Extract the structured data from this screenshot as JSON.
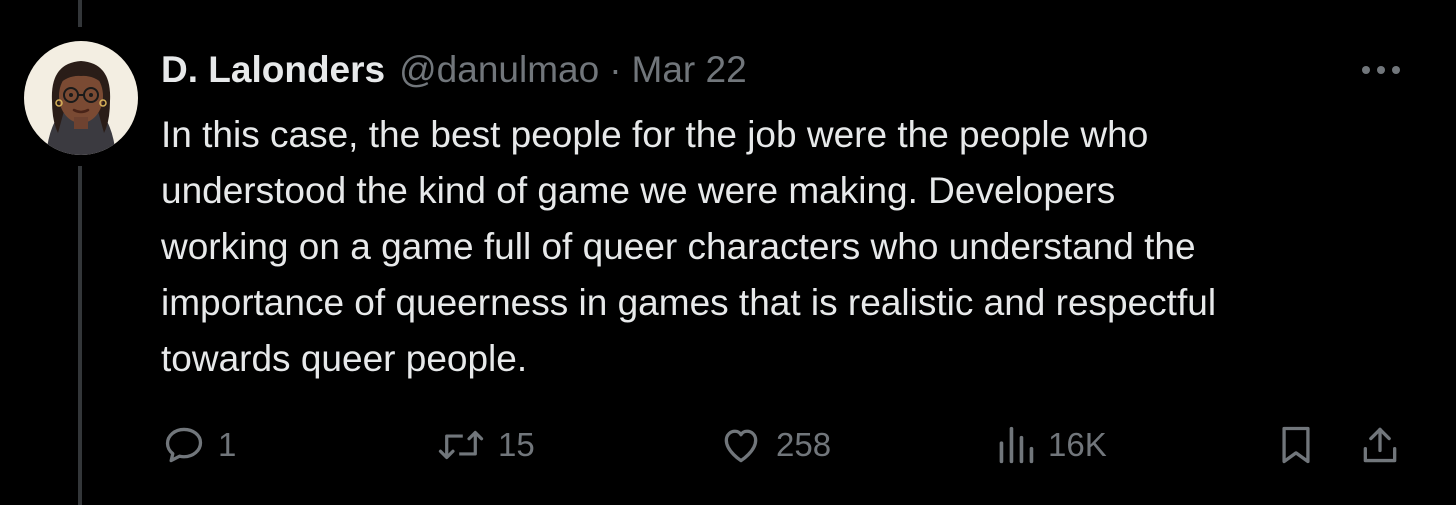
{
  "tweet": {
    "author": {
      "display_name": "D. Lalonders",
      "handle": "@danulmao",
      "avatar_icon": "avatar-illustration"
    },
    "separator": "·",
    "date": "Mar 22",
    "text": "In this case, the best people for the job were the people who\nunderstood the kind of game we were making. Developers\nworking on a game full of queer characters who understand the\nimportance of queerness in games that is realistic and respectful\ntowards queer people.",
    "more_icon": "more-icon",
    "actions": {
      "replies": {
        "icon": "reply-icon",
        "count": "1"
      },
      "reposts": {
        "icon": "retweet-icon",
        "count": "15"
      },
      "likes": {
        "icon": "heart-icon",
        "count": "258"
      },
      "views": {
        "icon": "views-icon",
        "count": "16K"
      },
      "bookmark": {
        "icon": "bookmark-icon"
      },
      "share": {
        "icon": "share-icon"
      }
    }
  },
  "colors": {
    "background": "#000000",
    "text_primary": "#e7e9ea",
    "text_secondary": "#71767b",
    "thread_line": "#333639"
  }
}
